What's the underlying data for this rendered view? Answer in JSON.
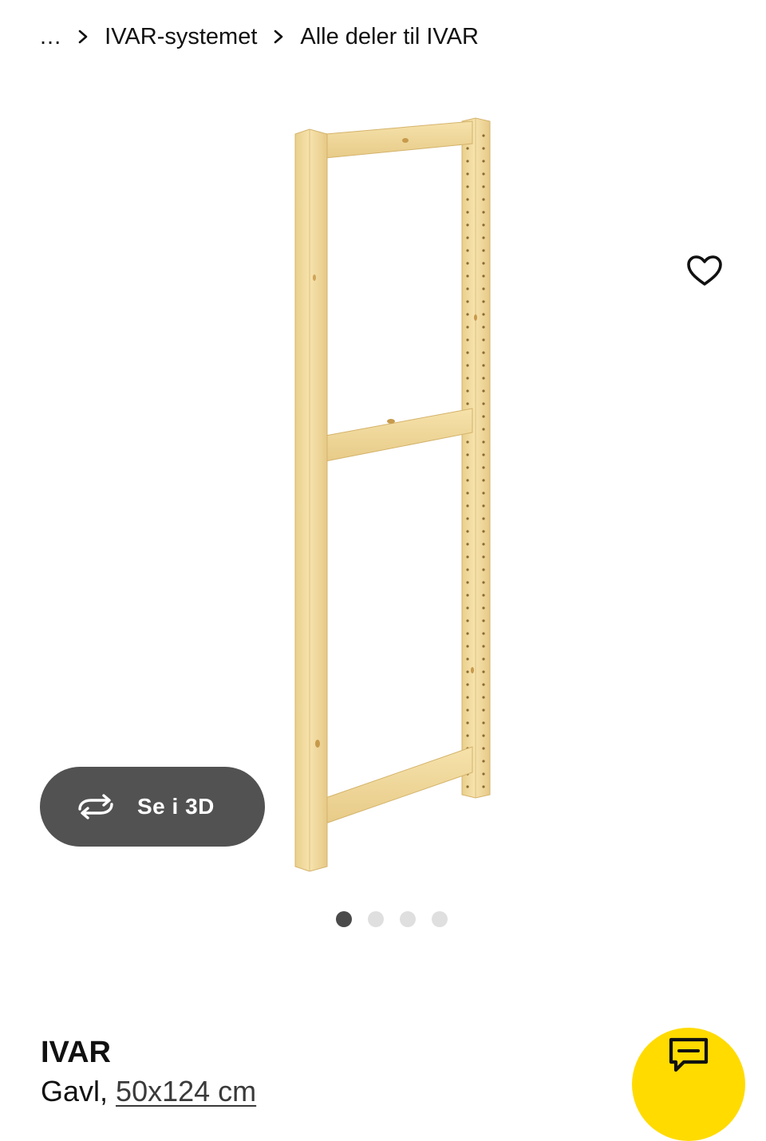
{
  "breadcrumb": {
    "items": [
      {
        "label": "..."
      },
      {
        "label": "IVAR-systemet"
      },
      {
        "label": "Alle deler til IVAR"
      }
    ],
    "separator_icon": "chevron-right-icon"
  },
  "gallery": {
    "favorite_icon": "heart-outline-icon",
    "view_3d": {
      "label": "Se i 3D",
      "icon": "rotate-3d-icon"
    },
    "image_count": 4,
    "active_index": 0
  },
  "product": {
    "name": "IVAR",
    "type": "Gavl,",
    "size": "50x124 cm"
  },
  "chat": {
    "icon": "chat-bubble-icon"
  },
  "colors": {
    "accent_yellow": "#ffdb00",
    "button_dark": "#525252",
    "dot_active": "#4a4a4a",
    "dot_inactive": "#dfdfdf",
    "wood": "#f3dc9f"
  }
}
